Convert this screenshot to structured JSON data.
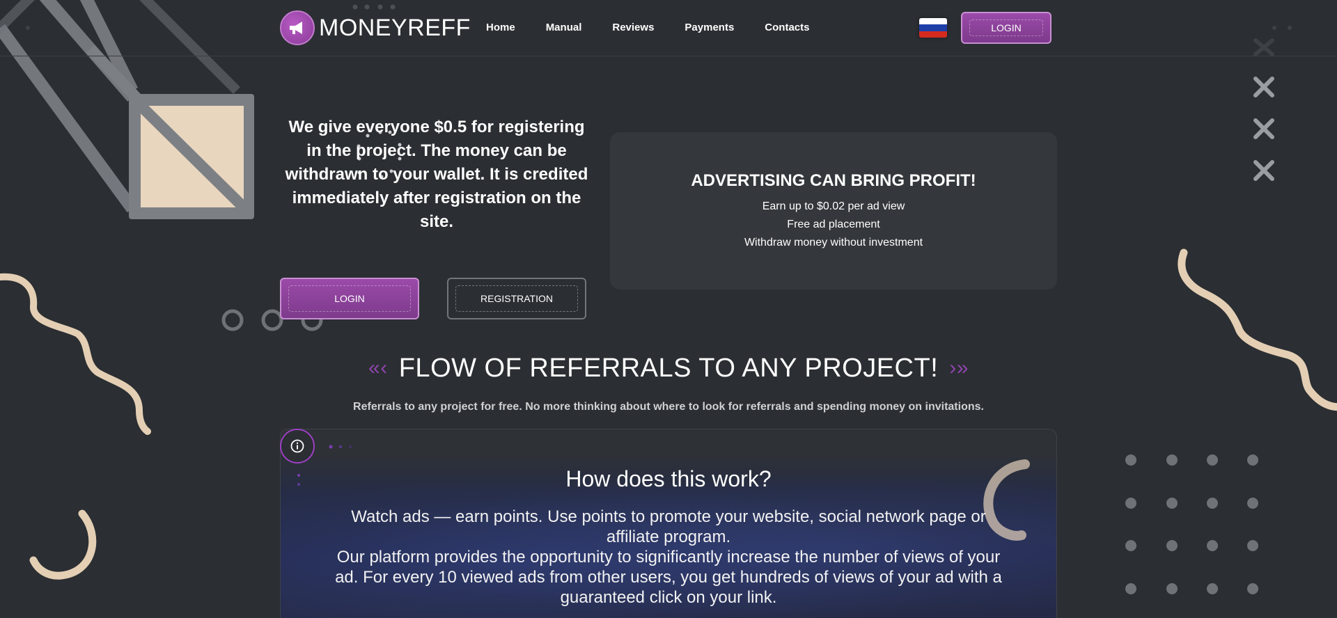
{
  "header": {
    "logo_text": "MONEYREFF",
    "nav": [
      "Home",
      "Manual",
      "Reviews",
      "Payments",
      "Contacts"
    ],
    "login_label": "LOGIN",
    "language_flag": "russian-flag"
  },
  "hero": {
    "text": "We give everyone $0.5 for registering in the project. The money can be withdrawn to your wallet. It is credited immediately after registration on the site.",
    "login_label": "LOGIN",
    "registration_label": "REGISTRATION"
  },
  "advertising": {
    "title": "ADVERTISING CAN BRING PROFIT!",
    "items": [
      "Earn up to $0.02 per ad view",
      "Free ad placement",
      "Withdraw money without investment"
    ]
  },
  "flow": {
    "title": "FLOW OF REFERRALS TO ANY PROJECT!",
    "subtitle": "Referrals to any project for free. No more thinking about where to look for referrals and spending money on invitations."
  },
  "how": {
    "title": "How does this work?",
    "paragraph_1": "Watch ads — earn points. Use points to promote your website, social network page or affiliate program.",
    "paragraph_2": "Our platform provides the opportunity to significantly increase the number of views of your ad. For every 10 viewed ads from other users, you get hundreds of views of your ad with a guaranteed click on your link."
  },
  "colors": {
    "background": "#2b2e32",
    "accent_purple": "#8e44ad",
    "button_purple": "#9b4aa9"
  }
}
